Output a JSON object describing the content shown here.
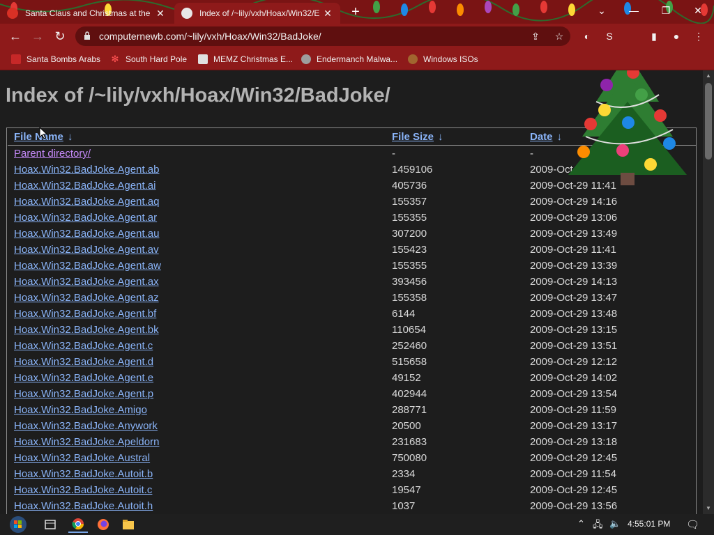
{
  "browser": {
    "tabs": [
      {
        "title": "Santa Claus and Christmas at the",
        "favicon_color": "#d93025",
        "active": false
      },
      {
        "title": "Index of /~lily/vxh/Hoax/Win32/E",
        "favicon_color": "#e8e8e8",
        "active": true
      }
    ],
    "new_tab_label": "+",
    "url": "computernewb.com/~lily/vxh/Hoax/Win32/BadJoke/",
    "bookmarks": [
      {
        "label": "Santa Bombs Arabs",
        "icon": "santa-icon"
      },
      {
        "label": "South Hard Pole",
        "icon": "snowflake-icon"
      },
      {
        "label": "MEMZ Christmas E...",
        "icon": "page-icon"
      },
      {
        "label": "Endermanch Malwa...",
        "icon": "raccoon-icon"
      },
      {
        "label": "Windows ISOs",
        "icon": "gingerbread-icon"
      }
    ],
    "theme_color": "#8e1a1a"
  },
  "page": {
    "heading": "Index of /~lily/vxh/Hoax/Win32/BadJoke/",
    "columns": {
      "name": "File Name",
      "size": "File Size",
      "date": "Date",
      "sort_arrow": "↓"
    },
    "parent": {
      "name": "Parent directory/",
      "size": "-",
      "date": "-"
    },
    "rows": [
      {
        "name": "Hoax.Win32.BadJoke.Agent.ab",
        "size": "1459106",
        "date": "2009-Oct-29 11:49"
      },
      {
        "name": "Hoax.Win32.BadJoke.Agent.ai",
        "size": "405736",
        "date": "2009-Oct-29 11:41"
      },
      {
        "name": "Hoax.Win32.BadJoke.Agent.aq",
        "size": "155357",
        "date": "2009-Oct-29 14:16"
      },
      {
        "name": "Hoax.Win32.BadJoke.Agent.ar",
        "size": "155355",
        "date": "2009-Oct-29 13:06"
      },
      {
        "name": "Hoax.Win32.BadJoke.Agent.au",
        "size": "307200",
        "date": "2009-Oct-29 13:49"
      },
      {
        "name": "Hoax.Win32.BadJoke.Agent.av",
        "size": "155423",
        "date": "2009-Oct-29 11:41"
      },
      {
        "name": "Hoax.Win32.BadJoke.Agent.aw",
        "size": "155355",
        "date": "2009-Oct-29 13:39"
      },
      {
        "name": "Hoax.Win32.BadJoke.Agent.ax",
        "size": "393456",
        "date": "2009-Oct-29 14:13"
      },
      {
        "name": "Hoax.Win32.BadJoke.Agent.az",
        "size": "155358",
        "date": "2009-Oct-29 13:47"
      },
      {
        "name": "Hoax.Win32.BadJoke.Agent.bf",
        "size": "6144",
        "date": "2009-Oct-29 13:48"
      },
      {
        "name": "Hoax.Win32.BadJoke.Agent.bk",
        "size": "110654",
        "date": "2009-Oct-29 13:15"
      },
      {
        "name": "Hoax.Win32.BadJoke.Agent.c",
        "size": "252460",
        "date": "2009-Oct-29 13:51"
      },
      {
        "name": "Hoax.Win32.BadJoke.Agent.d",
        "size": "515658",
        "date": "2009-Oct-29 12:12"
      },
      {
        "name": "Hoax.Win32.BadJoke.Agent.e",
        "size": "49152",
        "date": "2009-Oct-29 14:02"
      },
      {
        "name": "Hoax.Win32.BadJoke.Agent.p",
        "size": "402944",
        "date": "2009-Oct-29 13:54"
      },
      {
        "name": "Hoax.Win32.BadJoke.Amigo",
        "size": "288771",
        "date": "2009-Oct-29 11:59"
      },
      {
        "name": "Hoax.Win32.BadJoke.Anywork",
        "size": "20500",
        "date": "2009-Oct-29 13:17"
      },
      {
        "name": "Hoax.Win32.BadJoke.Apeldorn",
        "size": "231683",
        "date": "2009-Oct-29 13:18"
      },
      {
        "name": "Hoax.Win32.BadJoke.Austral",
        "size": "750080",
        "date": "2009-Oct-29 12:45"
      },
      {
        "name": "Hoax.Win32.BadJoke.Autoit.b",
        "size": "2334",
        "date": "2009-Oct-29 11:54"
      },
      {
        "name": "Hoax.Win32.BadJoke.Autoit.c",
        "size": "19547",
        "date": "2009-Oct-29 12:45"
      },
      {
        "name": "Hoax.Win32.BadJoke.Autoit.h",
        "size": "1037",
        "date": "2009-Oct-29 13:56"
      }
    ],
    "link_color": "#8ab4f8",
    "visited_color": "#c58af9"
  },
  "taskbar": {
    "clock": "4:55:01 PM",
    "apps": [
      "task-view-icon",
      "chrome-icon",
      "firefox-icon",
      "file-explorer-icon"
    ]
  }
}
